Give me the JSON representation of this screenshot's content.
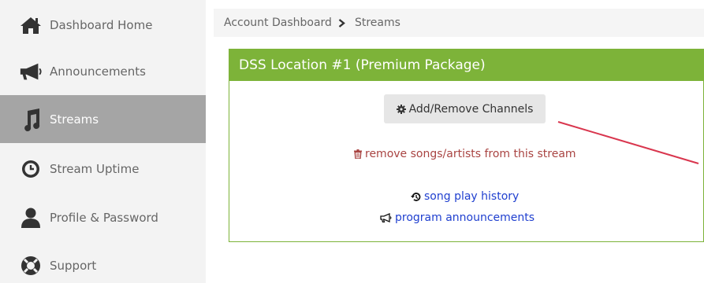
{
  "sidebar": {
    "items": [
      {
        "label": "Dashboard Home",
        "icon": "home-icon"
      },
      {
        "label": "Announcements",
        "icon": "megaphone-icon"
      },
      {
        "label": "Streams",
        "icon": "music-icon",
        "active": true
      },
      {
        "label": "Stream Uptime",
        "icon": "clock-icon"
      },
      {
        "label": "Profile & Password",
        "icon": "user-icon"
      },
      {
        "label": "Support",
        "icon": "lifebuoy-icon"
      }
    ]
  },
  "breadcrumb": {
    "root": "Account Dashboard",
    "current": "Streams"
  },
  "panel": {
    "title": "DSS Location #1 (Premium Package)",
    "add_remove_button": "Add/Remove Channels",
    "remove_link": "remove songs/artists from this stream",
    "history_link": "song play history",
    "announcements_link": "program announcements"
  },
  "colors": {
    "accent": "#7db339",
    "sidebar_bg": "#f3f3f3",
    "active_bg": "#a5a5a5",
    "danger": "#a94442",
    "link": "#1f3fcf",
    "annotation": "#d9364e"
  }
}
